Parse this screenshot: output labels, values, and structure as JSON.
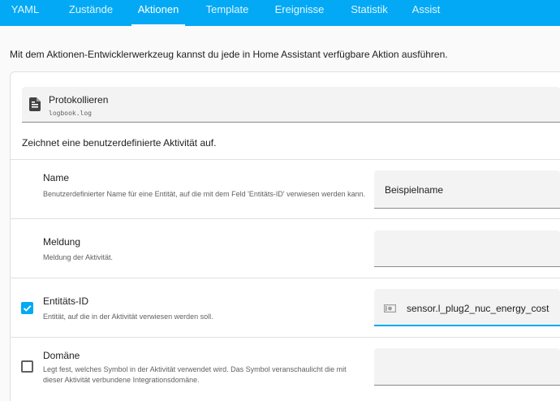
{
  "tabs": [
    {
      "label": "YAML",
      "active": false
    },
    {
      "label": "Zustände",
      "active": false
    },
    {
      "label": "Aktionen",
      "active": true
    },
    {
      "label": "Template",
      "active": false
    },
    {
      "label": "Ereignisse",
      "active": false
    },
    {
      "label": "Statistik",
      "active": false
    },
    {
      "label": "Assist",
      "active": false
    }
  ],
  "intro_text": "Mit dem Aktionen-Entwicklerwerkzeug kannst du jede in Home Assistant verfügbare Aktion ausführen.",
  "action": {
    "icon": "document-icon",
    "name": "Protokollieren",
    "id": "logbook.log",
    "description": "Zeichnet eine benutzerdefinierte Aktivität auf."
  },
  "fields": [
    {
      "title": "Name",
      "help": "Benutzerdefinierter Name für eine Entität, auf die mit dem Feld 'Entitäts-ID' verwiesen werden kann.",
      "value": "Beispielname",
      "checkbox": null
    },
    {
      "title": "Meldung",
      "help": "Meldung der Aktivität.",
      "value": "",
      "checkbox": null
    },
    {
      "title": "Entitäts-ID",
      "help": "Entität, auf die in der Aktivität verwiesen werden soll.",
      "value": "sensor.l_plug2_nuc_energy_cost",
      "checkbox": "checked",
      "icon": "cash-icon"
    },
    {
      "title": "Domäne",
      "help": "Legt fest, welches Symbol in der Aktivität verwendet wird. Das Symbol veranschaulicht die mit dieser Aktivität verbundene Integrationsdomäne.",
      "value": "",
      "checkbox": "unchecked"
    }
  ],
  "colors": {
    "primary": "#03a9f4",
    "text": "#212121",
    "secondary_text": "#616161",
    "field_background": "#f3f3f3"
  }
}
